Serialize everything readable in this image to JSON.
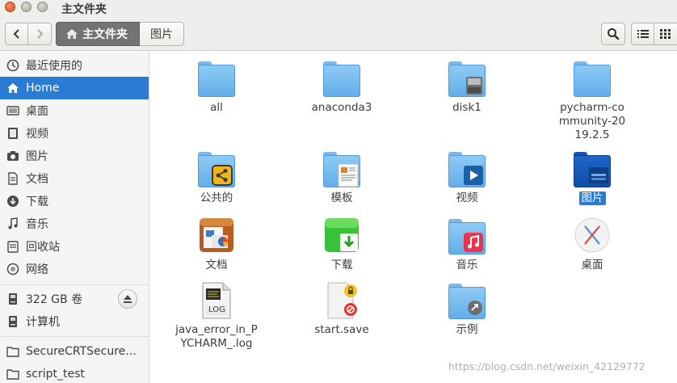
{
  "window": {
    "title": "主文件夹"
  },
  "toolbar": {
    "back_icon": "chevron-left-icon",
    "forward_icon": "chevron-right-icon",
    "breadcrumb_home": "主文件夹",
    "breadcrumb_pictures": "图片",
    "search_icon": "search-icon",
    "list_view_icon": "list-view-icon",
    "grid_view_icon": "grid-view-icon"
  },
  "sidebar": {
    "items": [
      {
        "label": "最近使用的",
        "icon": "clock-icon"
      },
      {
        "label": "Home",
        "icon": "home-icon",
        "active": true
      },
      {
        "label": "桌面",
        "icon": "desktop-icon"
      },
      {
        "label": "视频",
        "icon": "video-icon"
      },
      {
        "label": "图片",
        "icon": "camera-icon"
      },
      {
        "label": "文档",
        "icon": "document-icon"
      },
      {
        "label": "下载",
        "icon": "download-icon"
      },
      {
        "label": "音乐",
        "icon": "music-icon"
      },
      {
        "label": "回收站",
        "icon": "trash-icon"
      },
      {
        "label": "网络",
        "icon": "network-icon"
      },
      {
        "label": "322 GB 卷",
        "icon": "drive-icon"
      },
      {
        "label": "计算机",
        "icon": "computer-icon"
      },
      {
        "label": "SecureCRTSecure...",
        "icon": "folder-icon"
      },
      {
        "label": "script_test",
        "icon": "folder-icon"
      }
    ]
  },
  "files": [
    {
      "name": "all",
      "type": "folder"
    },
    {
      "name": "anaconda3",
      "type": "folder"
    },
    {
      "name": "disk1",
      "type": "folder-drive"
    },
    {
      "name": "pycharm-community-2019.2.5",
      "type": "folder"
    },
    {
      "name": "公共的",
      "type": "folder-share"
    },
    {
      "name": "模板",
      "type": "folder-templates"
    },
    {
      "name": "视频",
      "type": "folder-video"
    },
    {
      "name": "图片",
      "type": "folder-pictures",
      "selected": true
    },
    {
      "name": "文档",
      "type": "folder-documents"
    },
    {
      "name": "下载",
      "type": "folder-downloads"
    },
    {
      "name": "音乐",
      "type": "folder-music"
    },
    {
      "name": "桌面",
      "type": "desktop-x"
    },
    {
      "name": "java_error_in_PYCHARM_.log",
      "type": "log-file",
      "badge": "LOG"
    },
    {
      "name": "start.save",
      "type": "locked-file"
    },
    {
      "name": "示例",
      "type": "folder-link"
    }
  ],
  "watermark": "https://blog.csdn.net/weixin_42129772",
  "colors": {
    "accent": "#2a7bd4",
    "folder": "#62ade9",
    "close_button": "#e04a1f"
  }
}
